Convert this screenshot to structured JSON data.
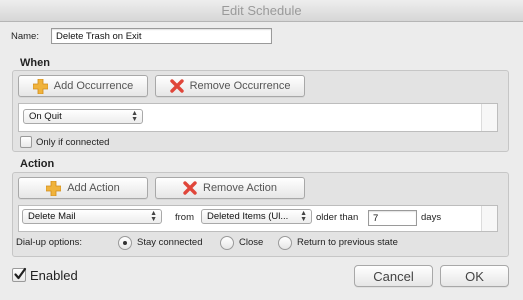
{
  "window": {
    "title": "Edit Schedule"
  },
  "name_field": {
    "label": "Name:",
    "value": "Delete Trash on Exit"
  },
  "when": {
    "title": "When",
    "add_label": "Add Occurrence",
    "remove_label": "Remove Occurrence",
    "occurrence_value": "On Quit",
    "only_connected_label": "Only if connected"
  },
  "action": {
    "title": "Action",
    "add_label": "Add Action",
    "remove_label": "Remove Action",
    "action_value": "Delete Mail",
    "from_label": "from",
    "folder_value": "Deleted Items (Ul...",
    "older_than_label": "older than",
    "days_value": "7",
    "days_label": "days"
  },
  "dialup": {
    "label": "Dial-up options:",
    "options": [
      "Stay connected",
      "Close",
      "Return to previous state"
    ],
    "selected": "Stay connected"
  },
  "footer": {
    "enabled_label": "Enabled",
    "enabled_checked": true,
    "cancel_label": "Cancel",
    "ok_label": "OK"
  },
  "colors": {
    "plus_icon": "#f0b33c",
    "remove_icon": "#e0463a"
  }
}
